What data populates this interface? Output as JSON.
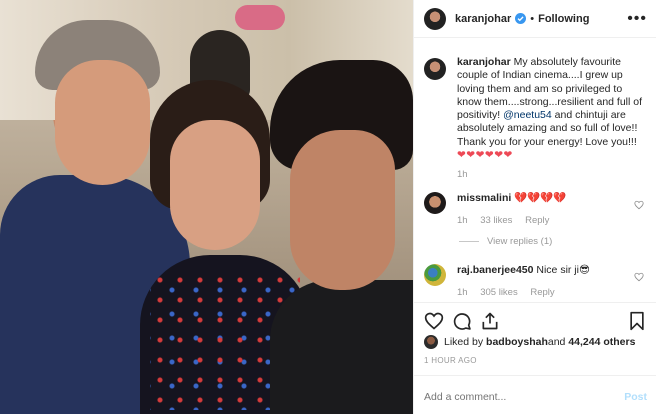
{
  "post_author": "karanjohar",
  "header": {
    "username": "karanjohar",
    "separator": "•",
    "follow_state": "Following",
    "more": "•••"
  },
  "caption": {
    "username": "karanjohar",
    "text_before_mention": " My absolutely favourite couple of Indian cinema....I grew up loving them and am so privileged to know them....strong...resilient and full of positivity! ",
    "mention": "@neetu54",
    "text_after_mention": " and chintuji are absolutely amazing and so full of love!! Thank you for your energy! Love you!!!",
    "hearts": "❤❤❤❤❤❤",
    "time": "1h"
  },
  "comments": [
    {
      "username": "missmalini",
      "text": "💔💔💔💔",
      "time": "1h",
      "likes": "33 likes",
      "reply": "Reply"
    },
    {
      "username": "raj.banerjee450",
      "text": "Nice sir ji😎",
      "time": "1h",
      "likes": "305 likes",
      "reply": "Reply"
    }
  ],
  "view_replies": "View replies (1)",
  "likes": {
    "prefix": "Liked by ",
    "user": "badboyshah",
    "middle": " and ",
    "count": "44,244 others"
  },
  "timestamp": "1 HOUR AGO",
  "add_comment": {
    "placeholder": "Add a comment...",
    "post_label": "Post"
  },
  "colors": {
    "verified": "#3897f0",
    "heart": "#ed4956",
    "muted": "#999999",
    "post_disabled": "#b2dffc"
  },
  "icons": [
    "verified-icon",
    "more-options-icon",
    "heart-outline-icon",
    "comment-icon",
    "share-icon",
    "bookmark-icon"
  ]
}
